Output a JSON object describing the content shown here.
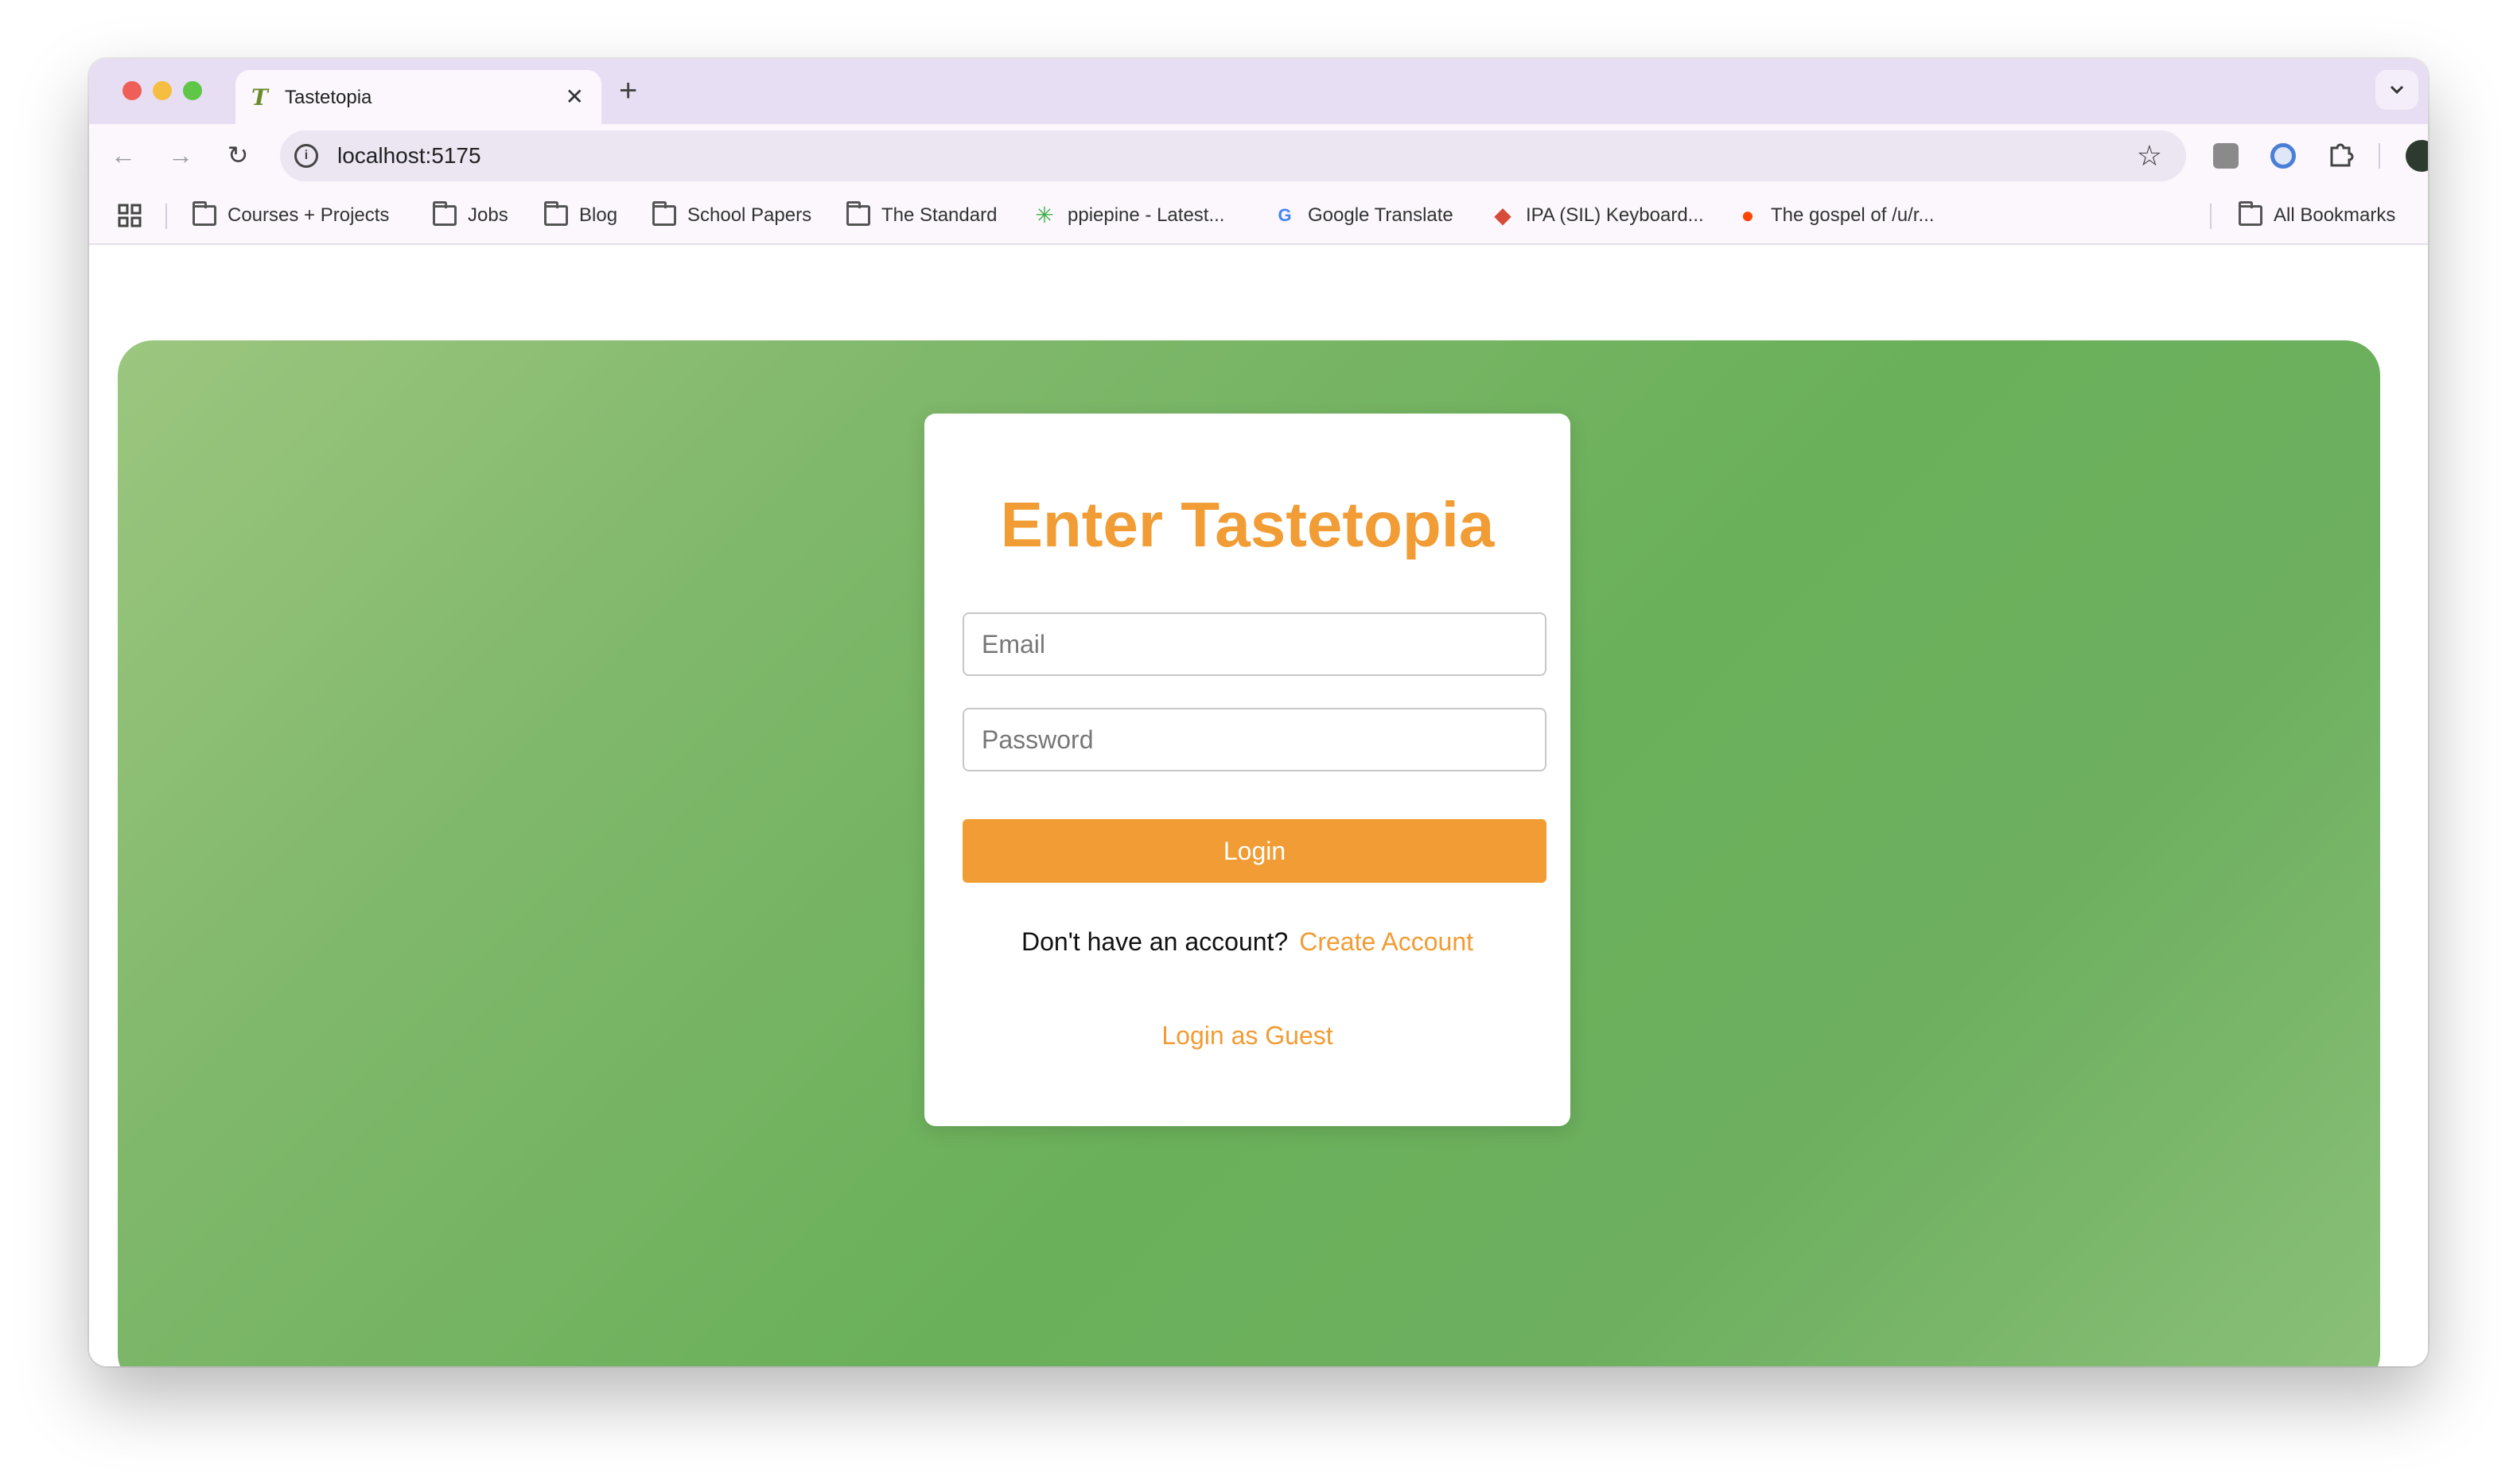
{
  "browser": {
    "tab": {
      "favicon": "T",
      "title": "Tastetopia",
      "close": "✕"
    },
    "new_tab": "+",
    "tab_menu": "⌄",
    "toolbar": {
      "back": "←",
      "forward": "→",
      "reload": "↻",
      "url": "localhost:5175",
      "info": "i",
      "star": "☆",
      "menu": "⋮"
    },
    "bookmarks": [
      {
        "label": "Courses + Projects",
        "icon": "folder-icon"
      },
      {
        "label": "Jobs",
        "icon": "folder-icon"
      },
      {
        "label": "Blog",
        "icon": "folder-icon"
      },
      {
        "label": "School Papers",
        "icon": "folder-icon"
      },
      {
        "label": "The Standard",
        "icon": "folder-icon"
      },
      {
        "label": "ppiepine - Latest...",
        "icon": "asterisk-icon"
      },
      {
        "label": "Google Translate",
        "icon": "translate-icon"
      },
      {
        "label": "IPA (SIL) Keyboard...",
        "icon": "cube-icon"
      },
      {
        "label": "The gospel of /u/r...",
        "icon": "reddit-icon"
      }
    ],
    "all_bookmarks": "All Bookmarks"
  },
  "login": {
    "title": "Enter Tastetopia",
    "email_placeholder": "Email",
    "password_placeholder": "Password",
    "login_button": "Login",
    "signup_prompt": "Don't have an account?",
    "create_account": "Create Account",
    "guest_login": "Login as Guest"
  },
  "colors": {
    "accent": "#f19c34",
    "panel_green": "#6ab05a",
    "chrome_tabstrip": "#e8def4"
  }
}
